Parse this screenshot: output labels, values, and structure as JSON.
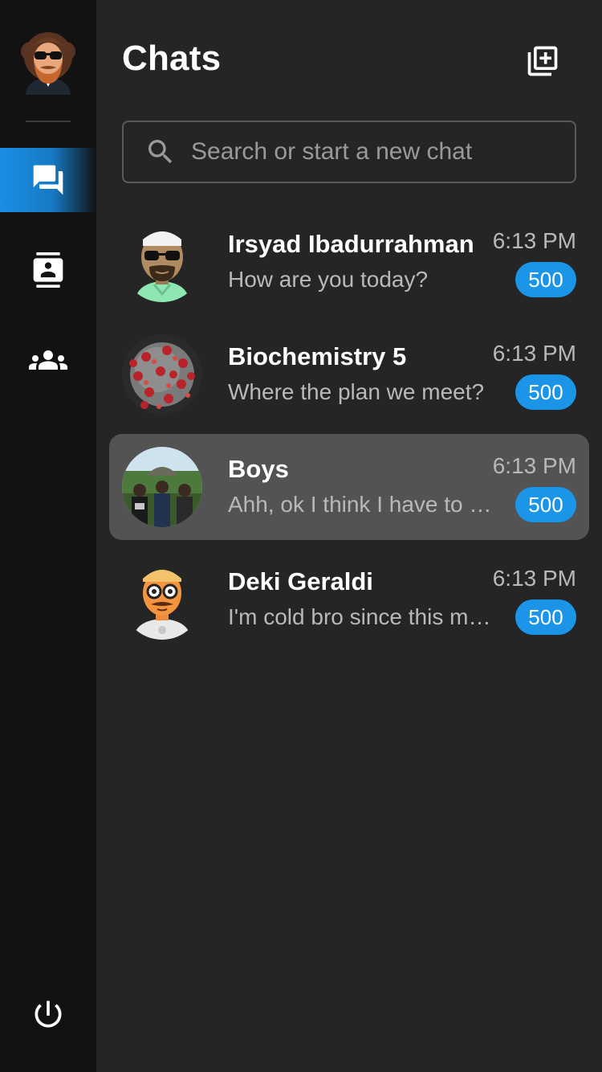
{
  "header": {
    "title": "Chats",
    "new_chat_icon": "new-chat-icon"
  },
  "search": {
    "placeholder": "Search or start a new chat",
    "icon": "search-icon"
  },
  "nav": {
    "items": [
      {
        "icon": "chats-icon",
        "active": true
      },
      {
        "icon": "contacts-icon",
        "active": false
      },
      {
        "icon": "groups-icon",
        "active": false
      }
    ],
    "logout_icon": "power-icon"
  },
  "chats": [
    {
      "name": "Irsyad Ibadurrahman",
      "preview": "How are you today?",
      "time": "6:13 PM",
      "unread": "500",
      "selected": false
    },
    {
      "name": "Biochemistry 5",
      "preview": "Where the plan we meet?",
      "time": "6:13 PM",
      "unread": "500",
      "selected": false
    },
    {
      "name": "Boys",
      "preview": "Ahh, ok I think I have to go now",
      "time": "6:13 PM",
      "unread": "500",
      "selected": true
    },
    {
      "name": "Deki Geraldi",
      "preview": "I'm cold bro since this morning",
      "time": "6:13 PM",
      "unread": "500",
      "selected": false
    }
  ],
  "colors": {
    "accent": "#1a95e8",
    "rail_bg": "#121212",
    "main_bg": "#252525",
    "selected_bg": "#535353"
  }
}
